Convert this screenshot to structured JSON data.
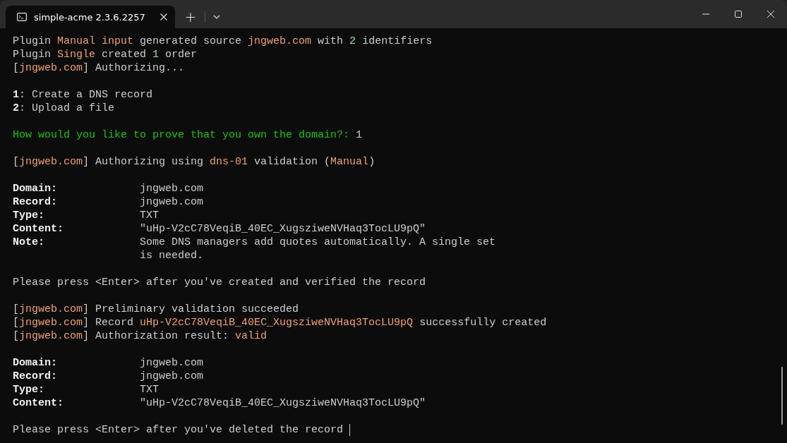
{
  "tab": {
    "title": "simple-acme 2.3.6.2257",
    "selected": true
  },
  "new_tab_button": "+",
  "lines": [
    {
      "kind": "text",
      "segments": [
        {
          "text": "Plugin ",
          "kind": "plain"
        },
        {
          "text": "Manual input",
          "kind": "accent"
        },
        {
          "text": " generated source ",
          "kind": "plain"
        },
        {
          "text": "jngweb.com",
          "kind": "accent"
        },
        {
          "text": " with ",
          "kind": "plain"
        },
        {
          "text": "2",
          "kind": "number"
        },
        {
          "text": " identifiers",
          "kind": "plain"
        }
      ]
    },
    {
      "kind": "text",
      "segments": [
        {
          "text": "Plugin ",
          "kind": "plain"
        },
        {
          "text": "Single",
          "kind": "accent"
        },
        {
          "text": " created ",
          "kind": "plain"
        },
        {
          "text": "1",
          "kind": "number"
        },
        {
          "text": " order",
          "kind": "plain"
        }
      ]
    },
    {
      "kind": "text",
      "segments": [
        {
          "text": "[",
          "kind": "plain"
        },
        {
          "text": "jngweb.com",
          "kind": "accent"
        },
        {
          "text": "] Authorizing...",
          "kind": "plain"
        }
      ]
    },
    {
      "kind": "blank"
    },
    {
      "kind": "text",
      "segments": [
        {
          "text": "1",
          "kind": "strong"
        },
        {
          "text": ": Create a DNS record",
          "kind": "plain"
        }
      ]
    },
    {
      "kind": "text",
      "segments": [
        {
          "text": "2",
          "kind": "strong"
        },
        {
          "text": ": Upload a file",
          "kind": "plain"
        }
      ]
    },
    {
      "kind": "blank"
    },
    {
      "kind": "text",
      "segments": [
        {
          "text": "How would you like to prove that you own the domain?:",
          "kind": "prompt"
        },
        {
          "text": " 1",
          "kind": "plain"
        }
      ]
    },
    {
      "kind": "blank"
    },
    {
      "kind": "text",
      "segments": [
        {
          "text": "[",
          "kind": "plain"
        },
        {
          "text": "jngweb.com",
          "kind": "accent"
        },
        {
          "text": "] Authorizing using ",
          "kind": "plain"
        },
        {
          "text": "dns-01",
          "kind": "accent"
        },
        {
          "text": " validation (",
          "kind": "plain"
        },
        {
          "text": "Manual",
          "kind": "accent"
        },
        {
          "text": ")",
          "kind": "plain"
        }
      ]
    },
    {
      "kind": "blank"
    },
    {
      "kind": "field",
      "label": "Domain:",
      "values": [
        "jngweb.com"
      ]
    },
    {
      "kind": "field",
      "label": "Record:",
      "values": [
        "jngweb.com"
      ]
    },
    {
      "kind": "field",
      "label": "Type:",
      "values": [
        "TXT"
      ]
    },
    {
      "kind": "field",
      "label": "Content:",
      "values": [
        "\"uHp-V2cC78VeqiB_40EC_XugsziweNVHaq3TocLU9pQ\""
      ]
    },
    {
      "kind": "field",
      "label": "Note:",
      "values": [
        "Some DNS managers add quotes automatically. A single set",
        "is needed."
      ]
    },
    {
      "kind": "blank"
    },
    {
      "kind": "text",
      "segments": [
        {
          "text": "Please press <Enter> after you've created and verified the record",
          "kind": "plain"
        }
      ]
    },
    {
      "kind": "blank"
    },
    {
      "kind": "text",
      "segments": [
        {
          "text": "[",
          "kind": "plain"
        },
        {
          "text": "jngweb.com",
          "kind": "accent"
        },
        {
          "text": "] Preliminary validation succeeded",
          "kind": "plain"
        }
      ]
    },
    {
      "kind": "text",
      "segments": [
        {
          "text": "[",
          "kind": "plain"
        },
        {
          "text": "jngweb.com",
          "kind": "accent"
        },
        {
          "text": "] Record ",
          "kind": "plain"
        },
        {
          "text": "uHp-V2cC78VeqiB_40EC_XugsziweNVHaq3TocLU9pQ",
          "kind": "accent"
        },
        {
          "text": " successfully created",
          "kind": "plain"
        }
      ]
    },
    {
      "kind": "text",
      "segments": [
        {
          "text": "[",
          "kind": "plain"
        },
        {
          "text": "jngweb.com",
          "kind": "accent"
        },
        {
          "text": "] Authorization result: ",
          "kind": "plain"
        },
        {
          "text": "valid",
          "kind": "accent"
        }
      ]
    },
    {
      "kind": "blank"
    },
    {
      "kind": "field",
      "label": "Domain:",
      "values": [
        "jngweb.com"
      ]
    },
    {
      "kind": "field",
      "label": "Record:",
      "values": [
        "jngweb.com"
      ]
    },
    {
      "kind": "field",
      "label": "Type:",
      "values": [
        "TXT"
      ]
    },
    {
      "kind": "field",
      "label": "Content:",
      "values": [
        "\"uHp-V2cC78VeqiB_40EC_XugsziweNVHaq3TocLU9pQ\""
      ]
    },
    {
      "kind": "blank"
    },
    {
      "kind": "text",
      "cursor": true,
      "segments": [
        {
          "text": "Please press <Enter> after you've deleted the record",
          "kind": "plain"
        }
      ]
    }
  ]
}
